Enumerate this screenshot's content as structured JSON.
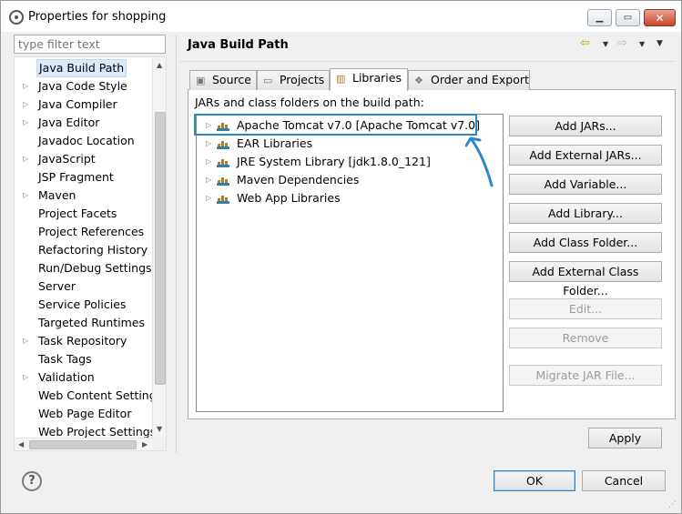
{
  "window": {
    "title": "Properties for shopping"
  },
  "filter": {
    "placeholder": "type filter text"
  },
  "tree": [
    {
      "label": "Java Build Path",
      "expandable": false,
      "selected": true
    },
    {
      "label": "Java Code Style",
      "expandable": true
    },
    {
      "label": "Java Compiler",
      "expandable": true
    },
    {
      "label": "Java Editor",
      "expandable": true
    },
    {
      "label": "Javadoc Location",
      "expandable": false
    },
    {
      "label": "JavaScript",
      "expandable": true
    },
    {
      "label": "JSP Fragment",
      "expandable": false
    },
    {
      "label": "Maven",
      "expandable": true
    },
    {
      "label": "Project Facets",
      "expandable": false
    },
    {
      "label": "Project References",
      "expandable": false
    },
    {
      "label": "Refactoring History",
      "expandable": false
    },
    {
      "label": "Run/Debug Settings",
      "expandable": false
    },
    {
      "label": "Server",
      "expandable": false
    },
    {
      "label": "Service Policies",
      "expandable": false
    },
    {
      "label": "Targeted Runtimes",
      "expandable": false
    },
    {
      "label": "Task Repository",
      "expandable": true
    },
    {
      "label": "Task Tags",
      "expandable": false
    },
    {
      "label": "Validation",
      "expandable": true
    },
    {
      "label": "Web Content Settings",
      "expandable": false
    },
    {
      "label": "Web Page Editor",
      "expandable": false
    },
    {
      "label": "Web Project Settings",
      "expandable": false
    }
  ],
  "page": {
    "title": "Java Build Path"
  },
  "tabs": [
    {
      "label": "Source",
      "active": false
    },
    {
      "label": "Projects",
      "active": false
    },
    {
      "label": "Libraries",
      "active": true
    },
    {
      "label": "Order and Export",
      "active": false
    }
  ],
  "libraries": {
    "label": "JARs and class folders on the build path:",
    "items": [
      "Apache Tomcat v7.0 [Apache Tomcat v7.0]",
      "EAR Libraries",
      "JRE System Library [jdk1.8.0_121]",
      "Maven Dependencies",
      "Web App Libraries"
    ]
  },
  "side_buttons": [
    {
      "label": "Add JARs...",
      "enabled": true
    },
    {
      "label": "Add External JARs...",
      "enabled": true
    },
    {
      "label": "Add Variable...",
      "enabled": true
    },
    {
      "label": "Add Library...",
      "enabled": true
    },
    {
      "label": "Add Class Folder...",
      "enabled": true
    },
    {
      "label": "Add External Class Folder...",
      "enabled": true
    },
    {
      "label": "Edit...",
      "enabled": false
    },
    {
      "label": "Remove",
      "enabled": false
    },
    {
      "label": "Migrate JAR File...",
      "enabled": false
    }
  ],
  "apply_label": "Apply",
  "ok_label": "OK",
  "cancel_label": "Cancel",
  "accent": "#2e88c8"
}
